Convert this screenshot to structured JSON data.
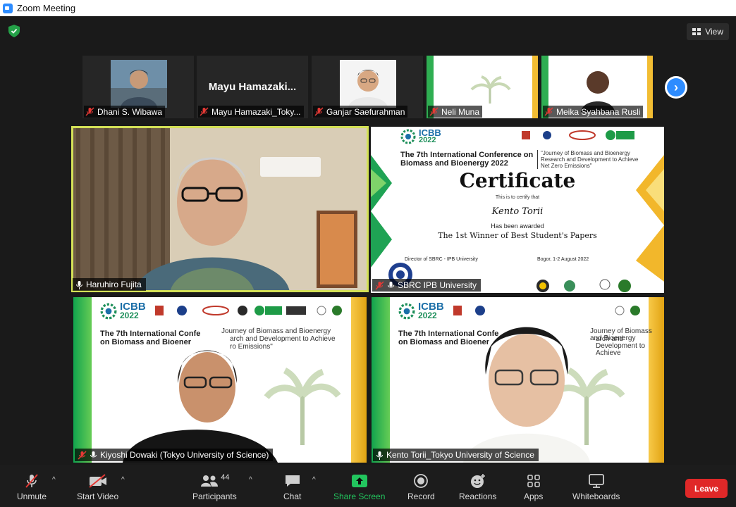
{
  "window": {
    "title": "Zoom Meeting"
  },
  "header": {
    "view_label": "View"
  },
  "strip": [
    {
      "name": "Dhani S. Wibawa"
    },
    {
      "name": "Mayu Hamazaki_Toky...",
      "display": "Mayu  Hamazaki..."
    },
    {
      "name": "Ganjar Saefurahman"
    },
    {
      "name": "Neli Muna"
    },
    {
      "name": "Meika Syahbana Rusli"
    }
  ],
  "gallery": [
    {
      "name": "Haruhiro Fujita"
    },
    {
      "name": "SBRC IPB University"
    },
    {
      "name": "Kiyoshi Dowaki (Tokyo University of Science)"
    },
    {
      "name": "Kento Torii_Tokyo University of Science"
    }
  ],
  "certificate": {
    "brand": "ICBB",
    "year": "2022",
    "conference": "The 7th International Conference on Biomass and Bioenergy 2022",
    "journey": "\"Journey of Biomass and Bioenergy Research and Development to Achieve Net Zero Emissions\"",
    "heading": "Certificate",
    "certify": "This is to certify that",
    "recipient": "Kento Torii",
    "awarded": "Has been awarded",
    "award": "The 1st Winner of Best Student's Papers",
    "director": "Director of SBRC - IPB University",
    "place_date": "Bogor, 1-2 August 2022"
  },
  "slide_bg": {
    "brand": "ICBB",
    "year": "2022",
    "conf_line1": "The 7th International Confe",
    "conf_line2": "on Biomass and Bioener",
    "journey_line1": "Journey of Biomass and Bioenergy",
    "journey_line2": "arch and Development to Achieve",
    "journey_line3": "ro Emissions\""
  },
  "toolbar": {
    "unmute": "Unmute",
    "start_video": "Start Video",
    "participants": "Participants",
    "participant_count": "44",
    "chat": "Chat",
    "share_screen": "Share Screen",
    "record": "Record",
    "reactions": "Reactions",
    "apps": "Apps",
    "whiteboards": "Whiteboards",
    "leave": "Leave"
  },
  "colors": {
    "accent": "#2d8cff",
    "leave": "#e02828",
    "share": "#22c55e",
    "active_speaker": "#d4e157"
  }
}
